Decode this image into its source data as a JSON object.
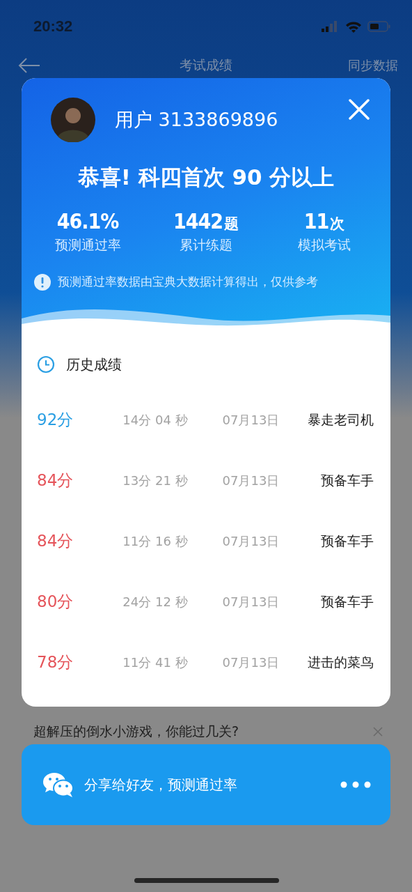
{
  "status_bar": {
    "time": "20:32"
  },
  "nav": {
    "title": "考试成绩",
    "action": "同步数据"
  },
  "result_card": {
    "username": "用户 3133869896",
    "headline": "恭喜! 科四首次 90 分以上",
    "stats": [
      {
        "value": "46.1%",
        "label": "预测通过率"
      },
      {
        "value": "1442",
        "unit": "题",
        "label": "累计练题"
      },
      {
        "value": "11",
        "unit": "次",
        "label": "模拟考试"
      }
    ],
    "notice": "预测通过率数据由宝典大数据计算得出，仅供参考",
    "history_title": "历史成绩",
    "history": [
      {
        "score": "92分",
        "color": "#2b9fe3",
        "duration": "14分 04 秒",
        "date": "07月13日",
        "title": "暴走老司机"
      },
      {
        "score": "84分",
        "color": "#e5545a",
        "duration": "13分 21 秒",
        "date": "07月13日",
        "title": "预备车手"
      },
      {
        "score": "84分",
        "color": "#e5545a",
        "duration": "11分 16 秒",
        "date": "07月13日",
        "title": "预备车手"
      },
      {
        "score": "80分",
        "color": "#e5545a",
        "duration": "24分 12 秒",
        "date": "07月13日",
        "title": "预备车手"
      },
      {
        "score": "78分",
        "color": "#e5545a",
        "duration": "11分 41 秒",
        "date": "07月13日",
        "title": "进击的菜鸟"
      }
    ]
  },
  "ad": {
    "text": "超解压的倒水小游戏，你能过几关?"
  },
  "share_bar": {
    "label": "分享给好友，预测通过率"
  }
}
